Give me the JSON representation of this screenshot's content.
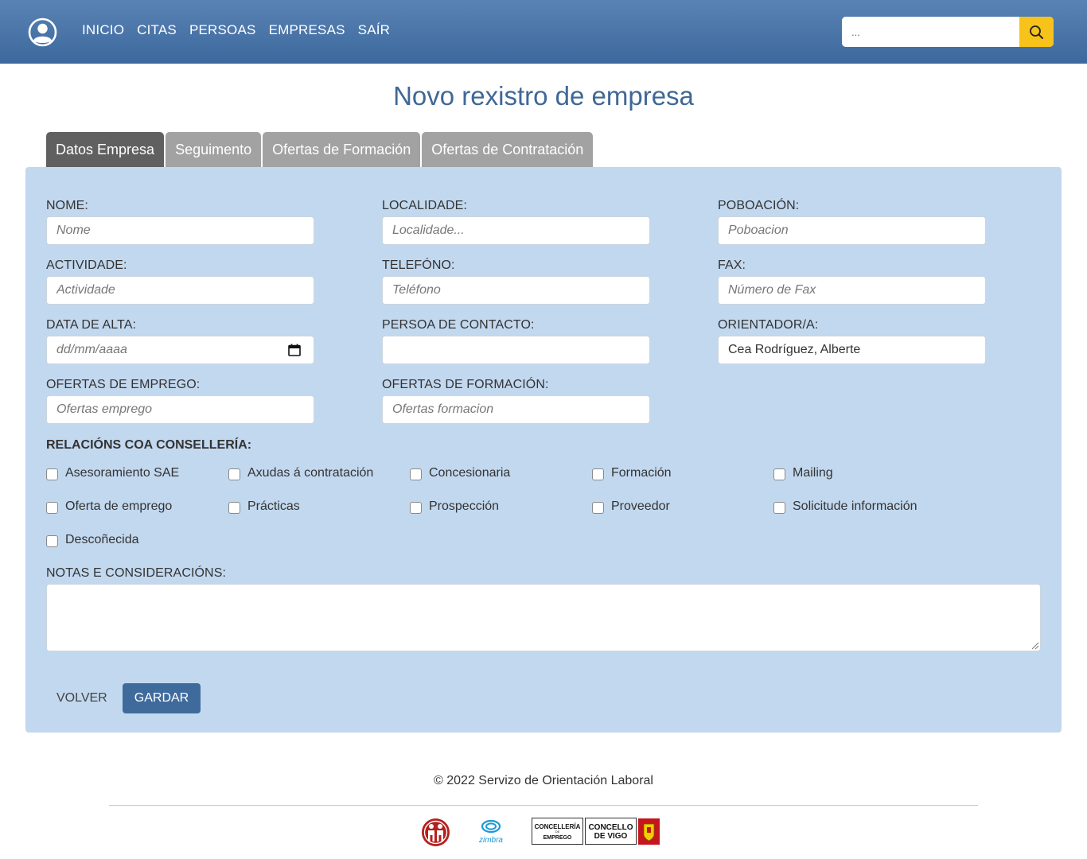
{
  "nav": {
    "links": [
      "INICIO",
      "CITAS",
      "PERSOAS",
      "EMPRESAS",
      "SAÍR"
    ],
    "search_placeholder": "..."
  },
  "page": {
    "title": "Novo rexistro de empresa"
  },
  "tabs": [
    "Datos Empresa",
    "Seguimento",
    "Ofertas de Formación",
    "Ofertas de Contratación"
  ],
  "form": {
    "nome": {
      "label": "NOME:",
      "placeholder": "Nome",
      "value": ""
    },
    "localidade": {
      "label": "LOCALIDADE:",
      "placeholder": "Localidade...",
      "value": ""
    },
    "poboacion": {
      "label": "POBOACIÓN:",
      "placeholder": "Poboacion",
      "value": ""
    },
    "actividade": {
      "label": "ACTIVIDADE:",
      "placeholder": "Actividade",
      "value": ""
    },
    "telefono": {
      "label": "TELEFÓNO:",
      "placeholder": "Teléfono",
      "value": ""
    },
    "fax": {
      "label": "FAX:",
      "placeholder": "Número de Fax",
      "value": ""
    },
    "data_alta": {
      "label": "DATA DE ALTA:",
      "placeholder": "dd/mm/aaaa",
      "value": ""
    },
    "persoa_contacto": {
      "label": "PERSOA DE CONTACTO:",
      "placeholder": "",
      "value": ""
    },
    "orientador": {
      "label": "ORIENTADOR/A:",
      "placeholder": "",
      "value": "Cea Rodríguez, Alberte"
    },
    "ofertas_emprego": {
      "label": "OFERTAS DE EMPREGO:",
      "placeholder": "Ofertas emprego",
      "value": ""
    },
    "ofertas_formacion": {
      "label": "OFERTAS DE FORMACIÓN:",
      "placeholder": "Ofertas formacion",
      "value": ""
    },
    "relacions_heading": "RELACIÓNS COA CONSELLERÍA:",
    "checkboxes": [
      "Asesoramiento SAE",
      "Axudas á contratación",
      "Concesionaria",
      "Formación",
      "Mailing",
      "Oferta de emprego",
      "Prácticas",
      "Prospección",
      "Proveedor",
      "Solicitude información",
      "Descoñecida"
    ],
    "notas_label": "NOTAS E CONSIDERACIÓNS:",
    "notas_value": "",
    "back_label": "VOLVER",
    "save_label": "GARDAR"
  },
  "footer": {
    "copyright": "© 2022 Servizo de Orientación Laboral",
    "logos": {
      "zimbra": "zimbra",
      "concelleria_line1": "CONCELLERÍA",
      "concelleria_line2": "DE",
      "concelleria_line3": "EMPREGO",
      "concello_line1": "CONCELLO",
      "concello_line2": "DE VIGO"
    }
  },
  "colors": {
    "navbar": "#4a76aa",
    "search_button": "#f7c21a",
    "panel": "#c2d8ef",
    "title": "#3f6896",
    "tab_active": "#606060",
    "tab_inactive": "#a2a2a2",
    "save_button": "#3f6b9c"
  }
}
